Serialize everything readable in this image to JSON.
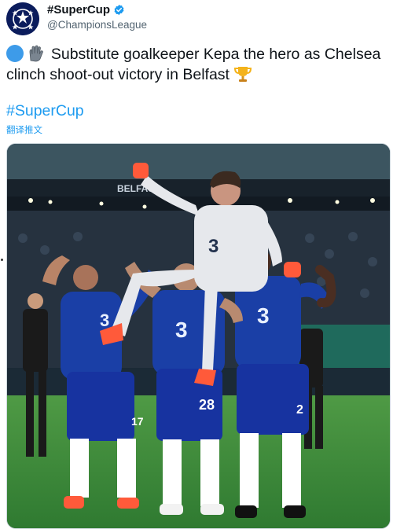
{
  "tweet": {
    "display_name": "#SuperCup",
    "handle": "@ChampionsLeague",
    "text_main": "Substitute goalkeeper Kepa the hero as Chelsea clinch shoot-out victory in Belfast",
    "hashtag": "#SuperCup",
    "translate_label": "翻译推文",
    "icons": [
      "ucl-starball-avatar",
      "verified-badge-icon",
      "blue-circle-emoji",
      "gloves-emoji",
      "trophy-emoji"
    ]
  },
  "photo": {
    "stadium_sign": "BELFAST",
    "shirt_numbers": [
      "3",
      "3",
      "3",
      "3",
      "28",
      "2",
      "17"
    ]
  },
  "colors": {
    "link": "#1d9bf0",
    "verified": "#1d9bf0",
    "chelsea_blue": "#1a3fa6",
    "pitch": "#3f8a3a"
  }
}
